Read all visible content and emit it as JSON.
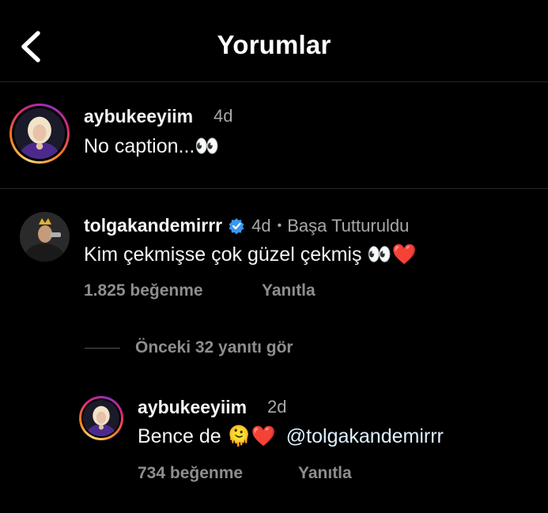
{
  "header": {
    "title": "Yorumlar"
  },
  "caption": {
    "username": "aybukeeyiim",
    "time": "4d",
    "text": "No caption...👀"
  },
  "comment": {
    "username": "tolgakandemirrr",
    "time": "4d",
    "separator": "•",
    "pinned": "Başa Tutturuldu",
    "text": "Kim çekmişse çok güzel çekmiş 👀❤️",
    "likes": "1.825 beğenme",
    "reply": "Yanıtla"
  },
  "view_replies": "Önceki 32 yanıtı gör",
  "reply": {
    "username": "aybukeeyiim",
    "time": "2d",
    "text_prefix": "Bence de 🫠❤️",
    "mention": "@tolgakandemirrr",
    "likes": "734 beğenme",
    "reply": "Yanıtla"
  },
  "colors": {
    "link": "#e0f1ff",
    "verified": "#3897f0"
  }
}
